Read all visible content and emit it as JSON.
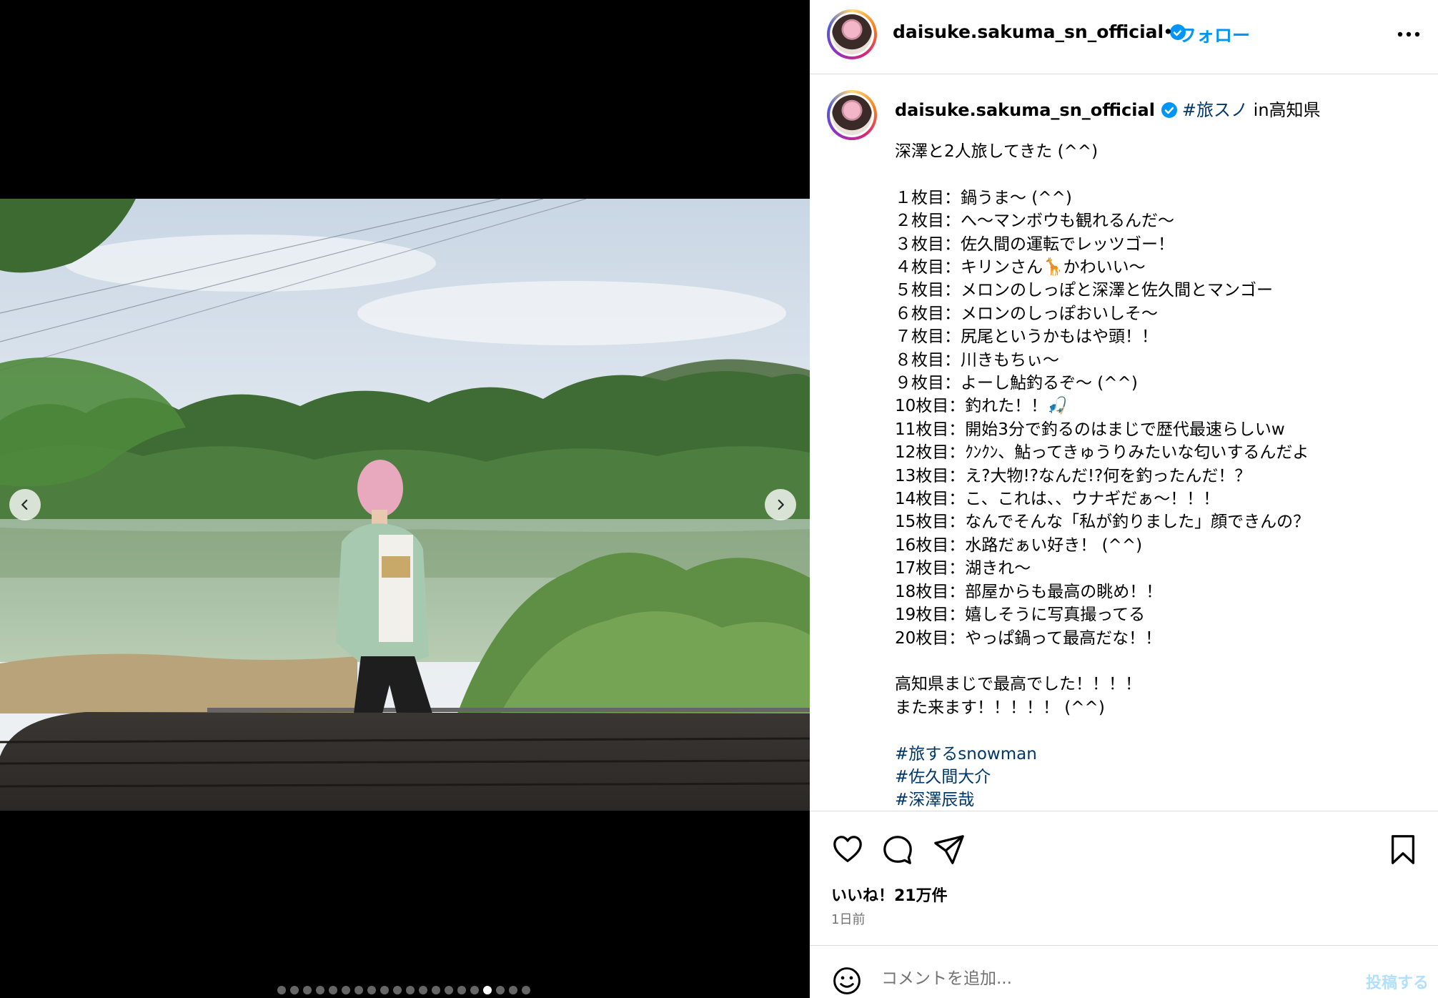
{
  "carousel": {
    "total_slides": 20,
    "active_slide": 17,
    "prev_icon": "chevron-left-icon",
    "next_icon": "chevron-right-icon"
  },
  "header": {
    "username": "daisuke.sakuma_sn_official",
    "separator": "•",
    "follow_label": "フォロー",
    "more_icon": "more-horizontal-icon"
  },
  "caption": {
    "username": "daisuke.sakuma_sn_official",
    "tag": "#旅スノ",
    "location": " in高知県",
    "lines": [
      "深澤と2人旅してきた (^^)",
      "",
      "１枚目：鍋うま〜 (^^)",
      "２枚目：へ〜マンボウも観れるんだ〜",
      "３枚目：佐久間の運転でレッツゴー！",
      "４枚目：キリンさん🦒かわいい〜",
      "５枚目：メロンのしっぽと深澤と佐久間とマンゴー",
      "６枚目：メロンのしっぽおいしそ〜",
      "７枚目：尻尾というかもはや頭！！",
      "８枚目：川きもちぃ〜",
      "９枚目：よーし鮎釣るぞ〜 (^^)",
      "10枚目：釣れた！！🎣",
      "11枚目：開始3分で釣るのはまじで歴代最速らしいw",
      "12枚目：ｸﾝｸﾝ、鮎ってきゅうりみたいな匂いするんだよ",
      "13枚目：え?大物!?なんだ!?何を釣ったんだ！？",
      "14枚目：こ、これは、、ウナギだぁ〜！！！",
      "15枚目：なんでそんな「私が釣りました」顔できんの？",
      "16枚目：水路だぁい好き！ (^^)",
      "17枚目：湖きれ〜",
      "18枚目：部屋からも最高の眺め！！",
      "19枚目：嬉しそうに写真撮ってる",
      "20枚目：やっぱ鍋って最高だな！！",
      "",
      "高知県まじで最高でした！！！！",
      "また来ます！！！！！ (^^)",
      ""
    ],
    "hashtags": [
      "#旅するsnowman",
      "#佐久間大介",
      "#深澤辰哉"
    ]
  },
  "actions": {
    "like_icon": "heart-icon",
    "comment_icon": "comment-icon",
    "share_icon": "send-icon",
    "save_icon": "bookmark-icon",
    "likes_text": "いいね！21万件",
    "time_text": "1日前"
  },
  "comment_bar": {
    "emoji_icon": "emoji-icon",
    "placeholder": "コメントを追加...",
    "post_label": "投稿する"
  },
  "colors": {
    "link": "#00376b",
    "follow": "#0095f6",
    "verified": "#0095f6",
    "muted": "#737373"
  }
}
